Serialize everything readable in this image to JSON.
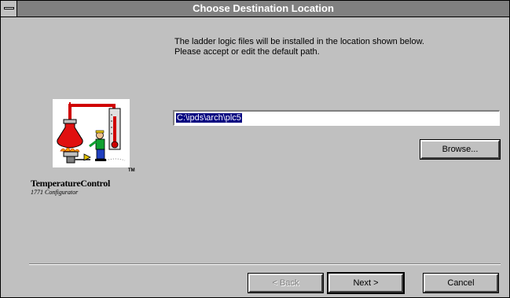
{
  "window": {
    "title": "Choose Destination Location"
  },
  "instructions": {
    "line1": "The ladder logic files will be installed in the location shown below.",
    "line2": "Please accept or edit the default path."
  },
  "logo": {
    "name": "TemperatureControl",
    "subtitle": "1771 Configurator",
    "tm": "TM"
  },
  "path": {
    "value": "C:\\ipds\\arch\\plc5"
  },
  "buttons": {
    "browse": "Browse...",
    "back": "< Back",
    "next": "Next >",
    "cancel": "Cancel"
  },
  "colors": {
    "titlebar": "#808080",
    "face": "#c0c0c0",
    "selection": "#000080"
  }
}
